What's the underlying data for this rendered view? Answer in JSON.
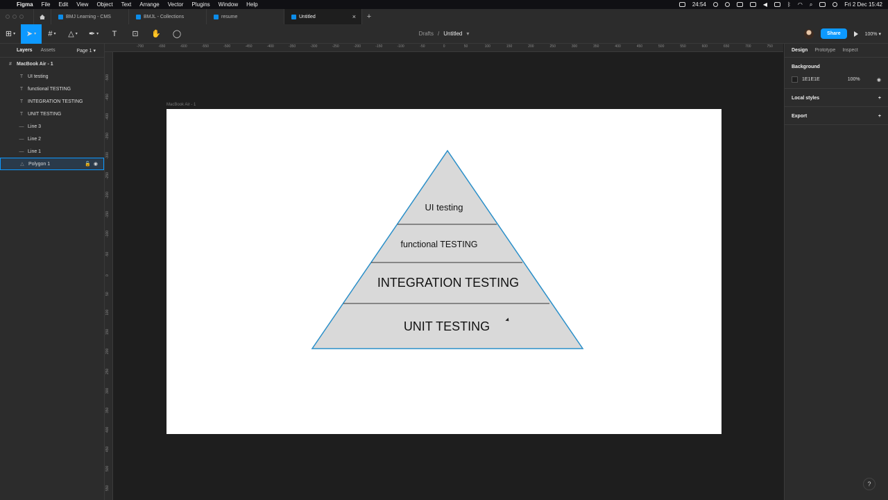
{
  "menubar": {
    "app": "Figma",
    "items": [
      "File",
      "Edit",
      "View",
      "Object",
      "Text",
      "Arrange",
      "Vector",
      "Plugins",
      "Window",
      "Help"
    ],
    "timer": "24:54",
    "clock": "Fri 2 Dec  15:42"
  },
  "tabs": [
    {
      "label": "BMJ Learning - CMS"
    },
    {
      "label": "BMJL - Collections"
    },
    {
      "label": "resume"
    },
    {
      "label": "Untitled",
      "active": true
    }
  ],
  "toolbar": {
    "breadcrumb_parent": "Drafts",
    "breadcrumb_sep": "/",
    "file_name": "Untitled",
    "share_label": "Share",
    "zoom": "100%"
  },
  "layers_panel": {
    "tab_layers": "Layers",
    "tab_assets": "Assets",
    "page": "Page 1",
    "frame": "MacBook Air - 1",
    "children": [
      {
        "name": "UI testing",
        "icon": "text-icon",
        "glyph": "T"
      },
      {
        "name": "functional TESTING",
        "icon": "text-icon",
        "glyph": "T"
      },
      {
        "name": "INTEGRATION TESTING",
        "icon": "text-icon",
        "glyph": "T"
      },
      {
        "name": "UNIT TESTING",
        "icon": "text-icon",
        "glyph": "T"
      },
      {
        "name": "Line 3",
        "icon": "line-icon",
        "glyph": "—"
      },
      {
        "name": "Line 2",
        "icon": "line-icon",
        "glyph": "—"
      },
      {
        "name": "Line 1",
        "icon": "line-icon",
        "glyph": "—"
      },
      {
        "name": "Polygon 1",
        "icon": "polygon-icon",
        "glyph": "△",
        "selected": true
      }
    ]
  },
  "ruler": {
    "top": [
      "-700",
      "-650",
      "-600",
      "-550",
      "-500",
      "-450",
      "-400",
      "-350",
      "-300",
      "-250",
      "-200",
      "-150",
      "-100",
      "-50",
      "0",
      "50",
      "100",
      "150",
      "200",
      "250",
      "300",
      "350",
      "400",
      "450",
      "500",
      "550",
      "600",
      "650",
      "700",
      "750"
    ],
    "left": [
      "-500",
      "-450",
      "-400",
      "-350",
      "-300",
      "-250",
      "-200",
      "-150",
      "-100",
      "-50",
      "0",
      "50",
      "100",
      "150",
      "200",
      "250",
      "300",
      "350",
      "400",
      "450",
      "500",
      "550"
    ]
  },
  "canvas": {
    "frame_label": "MacBook Air - 1",
    "pyramid_labels": [
      "UI testing",
      "functional TESTING",
      "INTEGRATION TESTING",
      "UNIT TESTING"
    ]
  },
  "design_panel": {
    "tab_design": "Design",
    "tab_prototype": "Prototype",
    "tab_inspect": "Inspect",
    "background_title": "Background",
    "background_hex": "1E1E1E",
    "background_opacity": "100%",
    "local_styles": "Local styles",
    "export": "Export"
  },
  "colors": {
    "accent": "#0d99ff",
    "pyramid_fill": "#d9d9d9",
    "pyramid_stroke": "#2a8fc9"
  }
}
